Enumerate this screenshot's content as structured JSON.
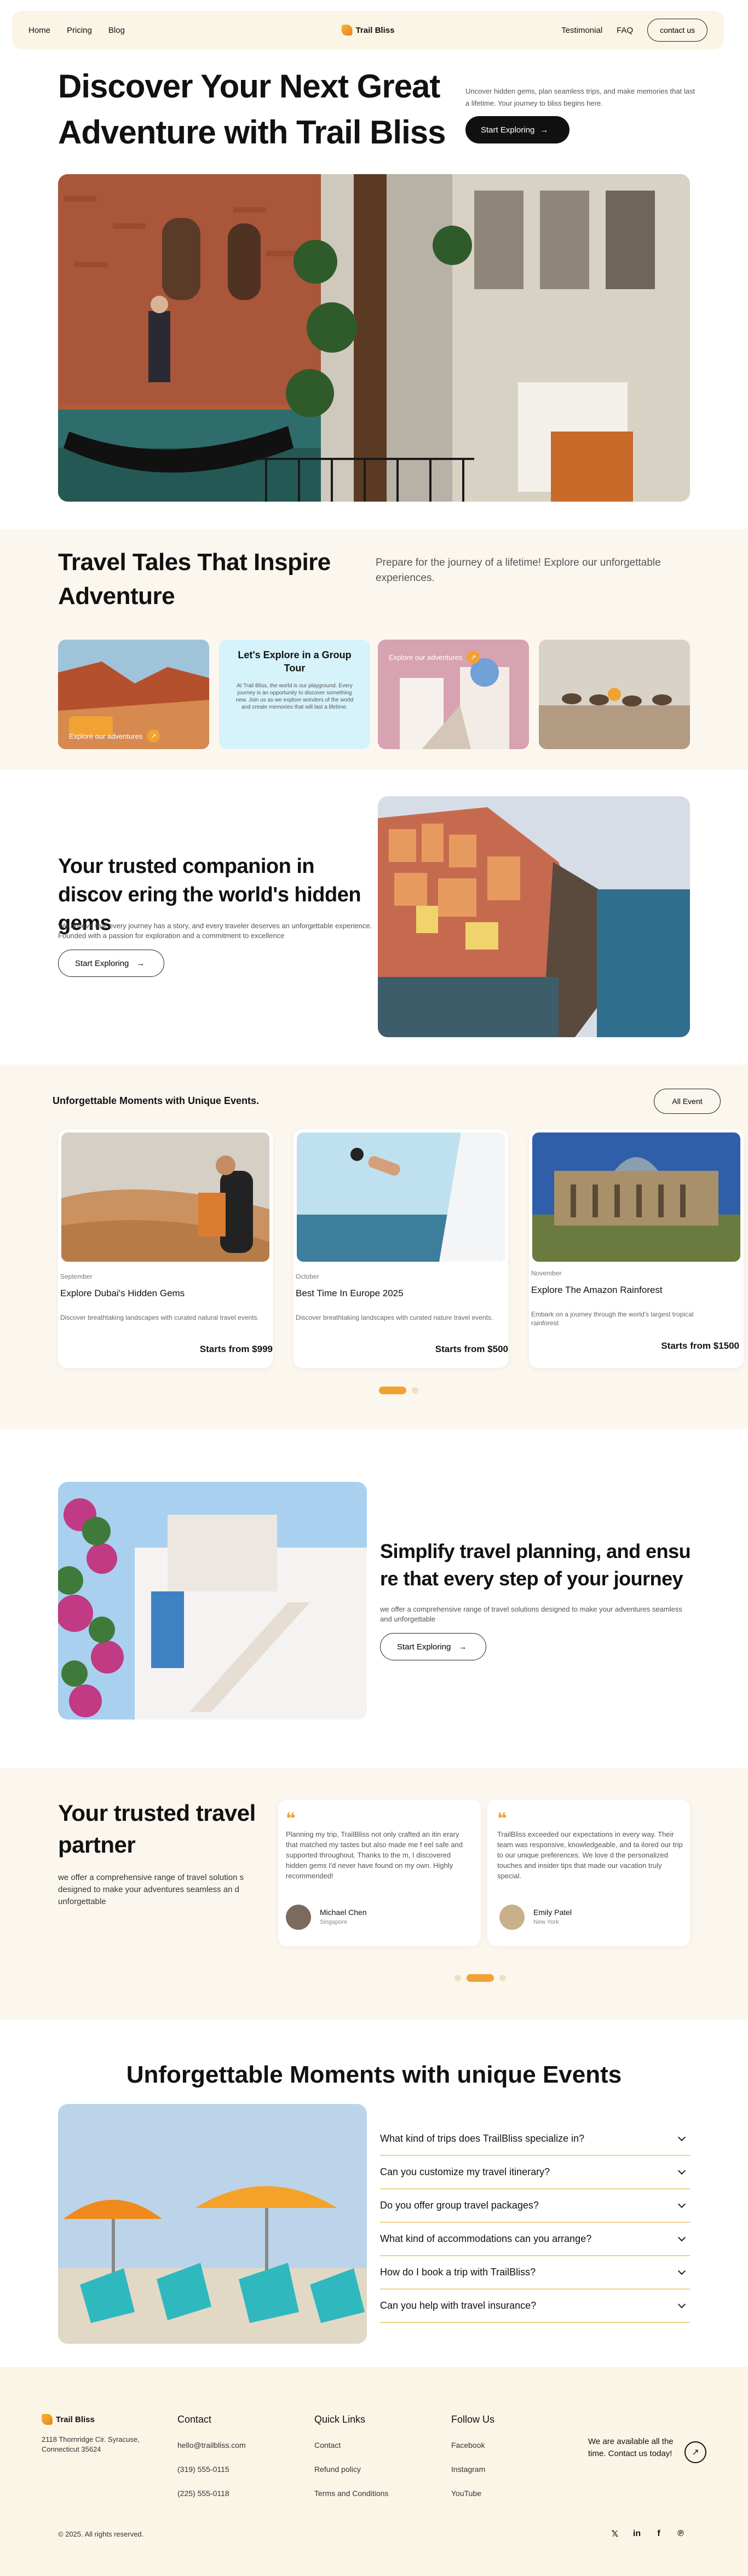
{
  "nav": {
    "links": [
      "Home",
      "Pricing",
      "Blog"
    ],
    "brand": "Trail Bliss",
    "right_links": [
      "Testimonial",
      "FAQ"
    ],
    "contact": "contact us"
  },
  "hero": {
    "title": "Discover Your Next Great Adventure with Trail Bliss",
    "desc": "Uncover hidden gems, plan seamless trips, and make memories that last a lifetime. Your journey to bliss begins here.",
    "cta": "Start Exploring"
  },
  "tales": {
    "title": "Travel Tales That Inspire Adventure",
    "desc": "Prepare for the journey of a lifetime! Explore our unforgettable experiences.",
    "tile1_label": "Explore our adventures",
    "card_title": "Let's Explore in a Group Tour",
    "card_text": "At Trail Bliss, the world is our playground. Every journey is an opportunity to discover something new. Join us as we explore wonders of the world and create memories that will last a lifetime.",
    "tile3_label": "Explore our adventures"
  },
  "companion": {
    "title": "Your trusted companion in discov ering the world's hidden gems",
    "desc": "We believe that every journey has a story, and every traveler deserves an unforgettable experience. Founded with a passion for exploration and a commitment to excellence",
    "cta": "Start Exploring"
  },
  "moments": {
    "title": "Unforgettable Moments with Unique Events.",
    "all": "All Event",
    "cards": [
      {
        "month": "September",
        "title": "Explore Dubai's Hidden Gems",
        "desc": "Discover breathtaking landscapes with curated natural travel events.",
        "price": "Starts from $999"
      },
      {
        "month": "October",
        "title": "Best Time In Europe 2025",
        "desc": "Discover breathtaking landscapes with curated nature travel events.",
        "price": "Starts from $500"
      },
      {
        "month": "November",
        "title": "Explore The Amazon Rainforest",
        "desc": "Embark on a journey through the world's largest tropical rainforest",
        "price": "Starts from $1500"
      }
    ]
  },
  "simplify": {
    "title": "Simplify travel planning, and ensu re that every step of your journey",
    "desc": "we offer a comprehensive range of travel solutions designed to make your adventures seamless and unforgettable",
    "cta": "Start Exploring"
  },
  "testimonials": {
    "title": "Your trusted travel partner",
    "desc": "we offer a comprehensive range of travel solution s designed to make your adventures seamless an d unforgettable",
    "items": [
      {
        "text": "Planning my trip, TrailBliss not only crafted an itin erary that matched my tastes but also made me f eel safe and supported throughout. Thanks to the m, I discovered hidden gems I'd never have found on my own. Highly recommended!",
        "name": "Michael Chen",
        "place": "Singapore"
      },
      {
        "text": "TrailBliss exceeded our expectations in every way. Their team was responsive, knowledgeable, and ta ilored our trip to our unique preferences. We love d the personalized touches and insider tips that made our vacation truly special.",
        "name": "Emily Patel",
        "place": "New York"
      }
    ]
  },
  "faq": {
    "title": "Unforgettable Moments with unique Events",
    "items": [
      "What kind of trips does TrailBliss specialize in?",
      "Can you customize my travel itinerary?",
      "Do you offer group travel packages?",
      "What kind of accommodations can you arrange?",
      "How do I book a trip with TrailBliss?",
      "Can you help with travel insurance?"
    ]
  },
  "footer": {
    "brand": "Trail Bliss",
    "address": "2118 Thornridge Cir. Syracuse, Connecticut 35624",
    "contact_title": "Contact",
    "email": "hello@trailbliss.com",
    "phone1": "(319) 555-0115",
    "phone2": "(225) 555-0118",
    "quick_title": "Quick Links",
    "quick": [
      "Contact",
      "Refund policy",
      "Terms and Conditions"
    ],
    "follow_title": "Follow Us",
    "follow": [
      "Facebook",
      "Instagram",
      "YouTube"
    ],
    "avail": "We are available all the time. Contact us today!",
    "copyright": "© 2025. All rights reserved."
  },
  "colors": {
    "accent": "#f2a233",
    "cream": "#fbf7ef",
    "nav_bg": "#fbf5e6",
    "group_card": "#d6f3fb"
  }
}
